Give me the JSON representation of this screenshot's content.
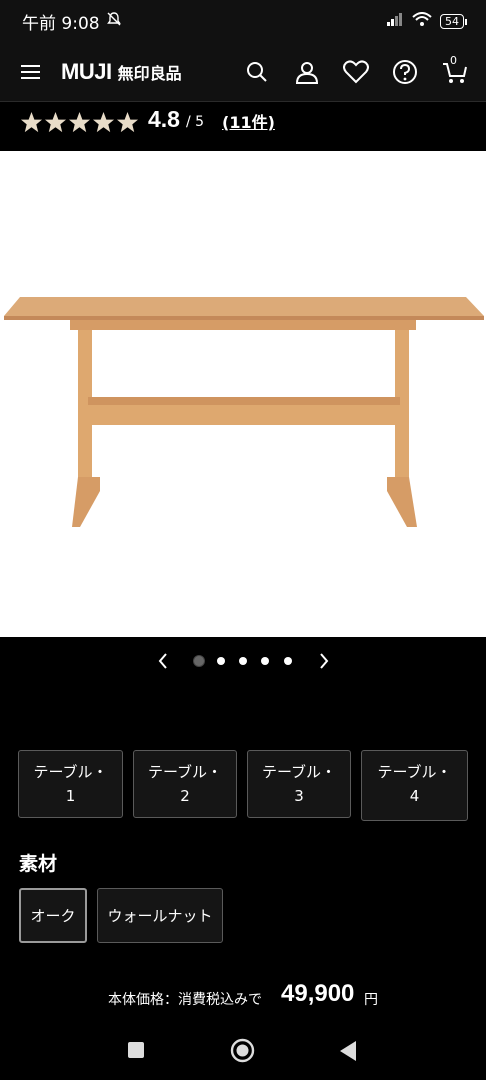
{
  "status": {
    "time": "午前 9:08",
    "battery": "54"
  },
  "header": {
    "logo_en": "MUJI",
    "logo_jp": "無印良品",
    "cart_count": "0"
  },
  "rating": {
    "value": "4.8",
    "max": "/ 5",
    "reviews": "(11件)",
    "stars": 5
  },
  "variants": [
    {
      "line1": "テーブル・",
      "line2": "1"
    },
    {
      "line1": "テーブル・",
      "line2": "2"
    },
    {
      "line1": "テーブル・",
      "line2": "3"
    },
    {
      "line1": "テーブル・",
      "line2": "4"
    }
  ],
  "material": {
    "title": "素材",
    "options": [
      "オーク",
      "ウォールナット"
    ],
    "selected": "オーク"
  },
  "price": {
    "label": "本体価格：消費税込みで",
    "value": "49,900",
    "unit": "円"
  },
  "carousel": {
    "total": 5,
    "active": 1
  },
  "colors": {
    "table_wood": "#d9a06a",
    "table_wood_dark": "#c4895a",
    "star": "#e8dcc8"
  }
}
